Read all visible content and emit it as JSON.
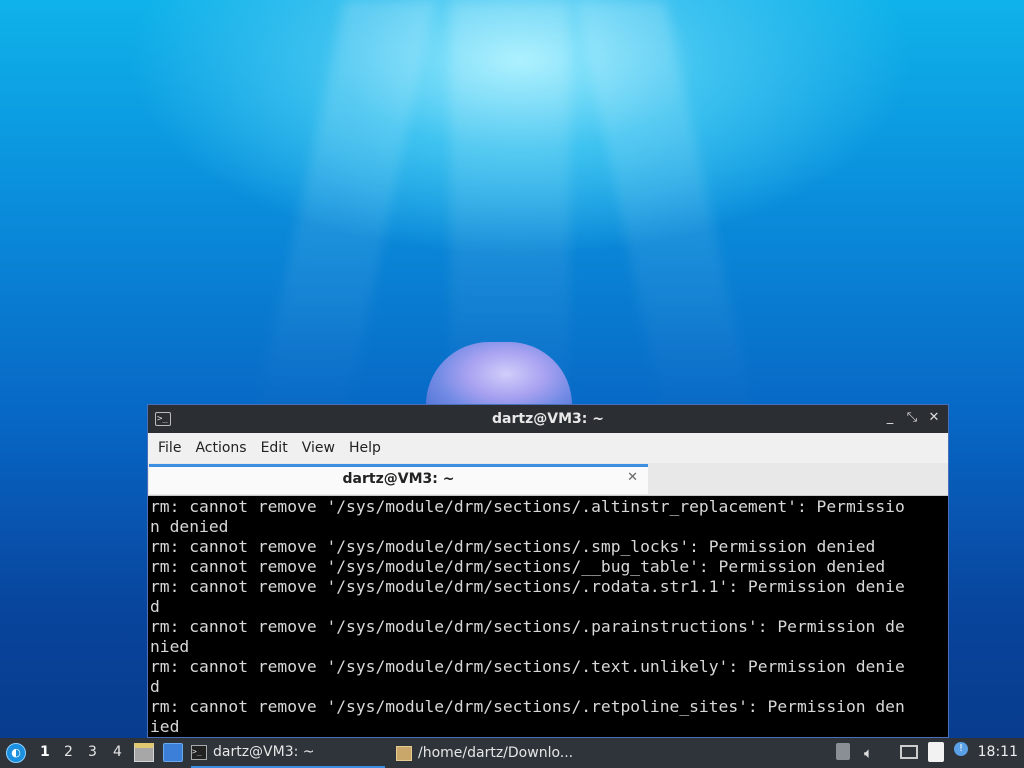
{
  "window": {
    "title": "dartz@VM3: ~",
    "controls": [
      "_",
      "⤡",
      "✕"
    ]
  },
  "menu": [
    "File",
    "Actions",
    "Edit",
    "View",
    "Help"
  ],
  "tab": {
    "title": "dartz@VM3: ~",
    "close": "✕"
  },
  "terminal_lines": [
    "rm: cannot remove '/sys/module/drm/sections/.altinstr_replacement': Permissio",
    "n denied",
    "rm: cannot remove '/sys/module/drm/sections/.smp_locks': Permission denied",
    "rm: cannot remove '/sys/module/drm/sections/__bug_table': Permission denied",
    "rm: cannot remove '/sys/module/drm/sections/.rodata.str1.1': Permission denie",
    "d",
    "rm: cannot remove '/sys/module/drm/sections/.parainstructions': Permission de",
    "nied",
    "rm: cannot remove '/sys/module/drm/sections/.text.unlikely': Permission denie",
    "d",
    "rm: cannot remove '/sys/module/drm/sections/.retpoline_sites': Permission den",
    "ied"
  ],
  "taskbar": {
    "workspaces": [
      "1",
      "2",
      "3",
      "4"
    ],
    "active_workspace": "1",
    "tasks": [
      {
        "label": "dartz@VM3: ~",
        "icon": "terminal-icon",
        "active": true
      },
      {
        "label": "/home/dartz/Downlo...",
        "icon": "archive-icon",
        "active": false
      }
    ],
    "clock": "18:11"
  },
  "colors": {
    "taskbar_bg": "#2f343a",
    "accent": "#3b8ee0",
    "titlebar_bg": "#2b2f34"
  }
}
